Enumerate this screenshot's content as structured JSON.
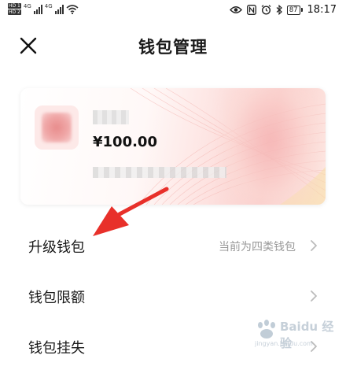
{
  "status_bar": {
    "hd_badges": [
      "HD 1",
      "HD 2"
    ],
    "network": [
      "4G",
      "4G"
    ],
    "battery": "87",
    "time": "18:17",
    "icons": [
      "eye-icon",
      "nfc-icon",
      "alarm-icon",
      "bluetooth-icon",
      "battery-icon",
      "wifi-icon",
      "signal-icon"
    ]
  },
  "header": {
    "title": "钱包管理",
    "close_icon": "close-icon"
  },
  "wallet_card": {
    "balance": "¥100.00",
    "accent": "#e88c8c"
  },
  "menu": {
    "items": [
      {
        "label": "升级钱包",
        "value": "当前为四类钱包"
      },
      {
        "label": "钱包限额",
        "value": ""
      },
      {
        "label": "钱包挂失",
        "value": ""
      }
    ]
  },
  "annotation": {
    "arrow_color": "#e8302a"
  },
  "watermark": {
    "brand": "Baidu 经验",
    "url": "jingyan.baidu.com"
  }
}
